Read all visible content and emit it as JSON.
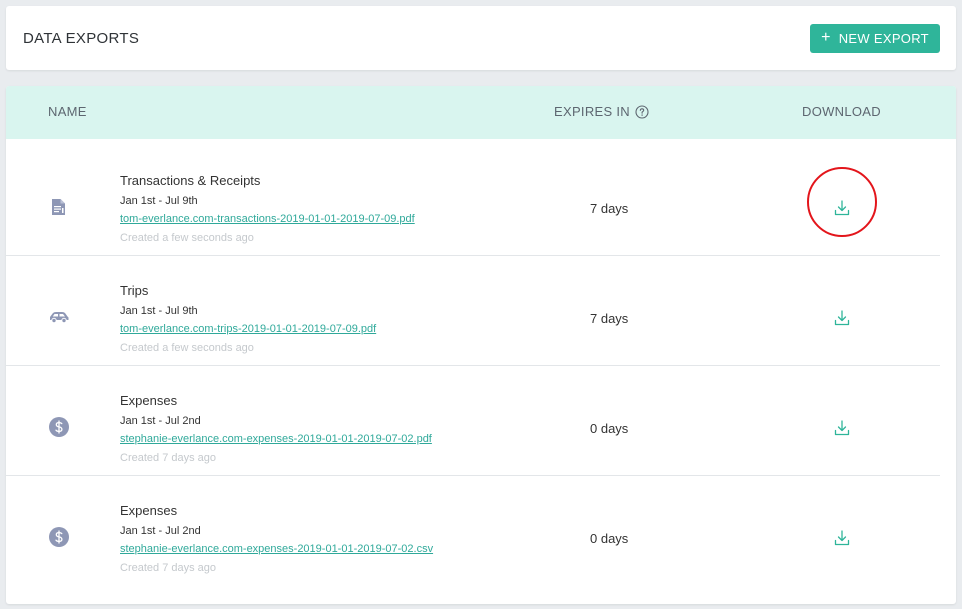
{
  "header": {
    "title": "DATA EXPORTS",
    "new_export_label": "NEW EXPORT"
  },
  "table": {
    "columns": {
      "name": "NAME",
      "expires": "EXPIRES IN",
      "download": "DOWNLOAD"
    },
    "rows": [
      {
        "icon": "receipt-icon",
        "title": "Transactions & Receipts",
        "range": "Jan 1st - Jul 9th",
        "file": "tom-everlance.com-transactions-2019-01-01-2019-07-09.pdf",
        "created": "Created a few seconds ago",
        "expires": "7 days"
      },
      {
        "icon": "car-icon",
        "title": "Trips",
        "range": "Jan 1st - Jul 9th",
        "file": "tom-everlance.com-trips-2019-01-01-2019-07-09.pdf",
        "created": "Created a few seconds ago",
        "expires": "7 days"
      },
      {
        "icon": "dollar-coin-icon",
        "title": "Expenses",
        "range": "Jan 1st - Jul 2nd",
        "file": "stephanie-everlance.com-expenses-2019-01-01-2019-07-02.pdf",
        "created": "Created 7 days ago",
        "expires": "0 days"
      },
      {
        "icon": "dollar-coin-icon",
        "title": "Expenses",
        "range": "Jan 1st - Jul 2nd",
        "file": "stephanie-everlance.com-expenses-2019-01-01-2019-07-02.csv",
        "created": "Created 7 days ago",
        "expires": "0 days"
      }
    ]
  },
  "colors": {
    "accent": "#2fb59a",
    "header_bg": "#d9f5ef",
    "icon": "#8e97b5",
    "highlight": "#e3151b"
  }
}
